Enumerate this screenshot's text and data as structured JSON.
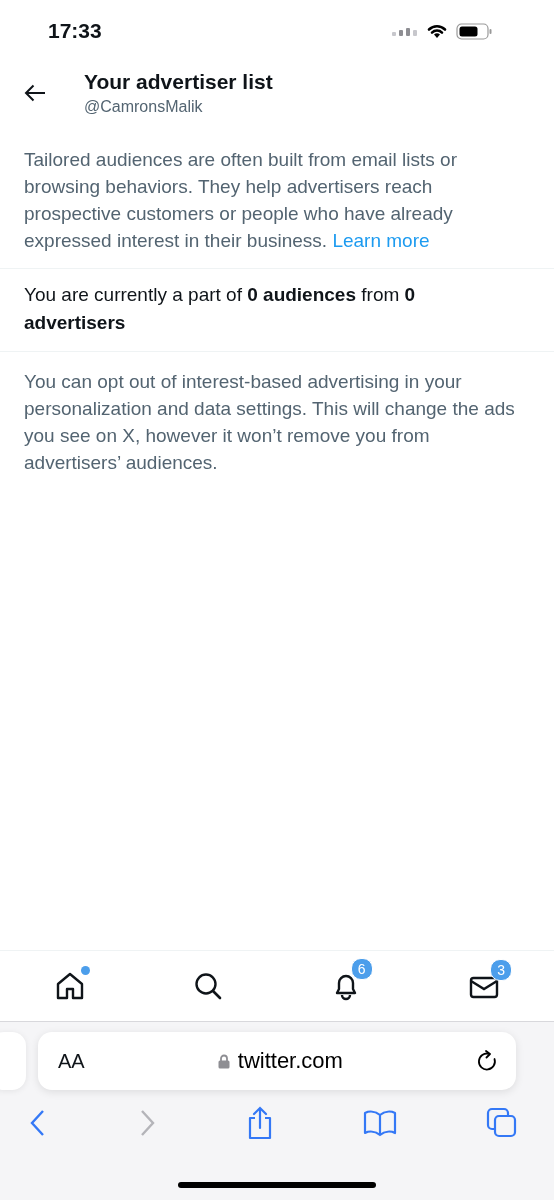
{
  "status_bar": {
    "time": "17:33"
  },
  "header": {
    "title": "Your advertiser list",
    "handle": "@CamronsMalik"
  },
  "intro": {
    "text": "Tailored audiences are often built from email lists or browsing behaviors. They help advertisers reach prospective customers or people who have already expressed interest in their business.",
    "link": "Learn more"
  },
  "summary": "You are currently a part of **0 audiences** from **0 advertisers**",
  "note": "You can opt out of interest-based advertising in your personalization and data settings. This will change the ads you see on X, however it won’t remove you from advertisers’ audiences.",
  "tab_bar": [
    {
      "kind": "home",
      "dot": true
    },
    {
      "kind": "search",
      "dot": false
    },
    {
      "kind": "notifications",
      "dot": false,
      "badge": "6"
    },
    {
      "kind": "messages",
      "dot": false,
      "badge": "3"
    }
  ],
  "browser": {
    "text_size": "AA",
    "url": "twitter.com",
    "toolbar": [
      {
        "kind": "back",
        "disabled": false
      },
      {
        "kind": "forward",
        "disabled": true
      },
      {
        "kind": "share",
        "disabled": false
      },
      {
        "kind": "bookmarks",
        "disabled": false
      },
      {
        "kind": "tabs",
        "disabled": false
      }
    ]
  }
}
